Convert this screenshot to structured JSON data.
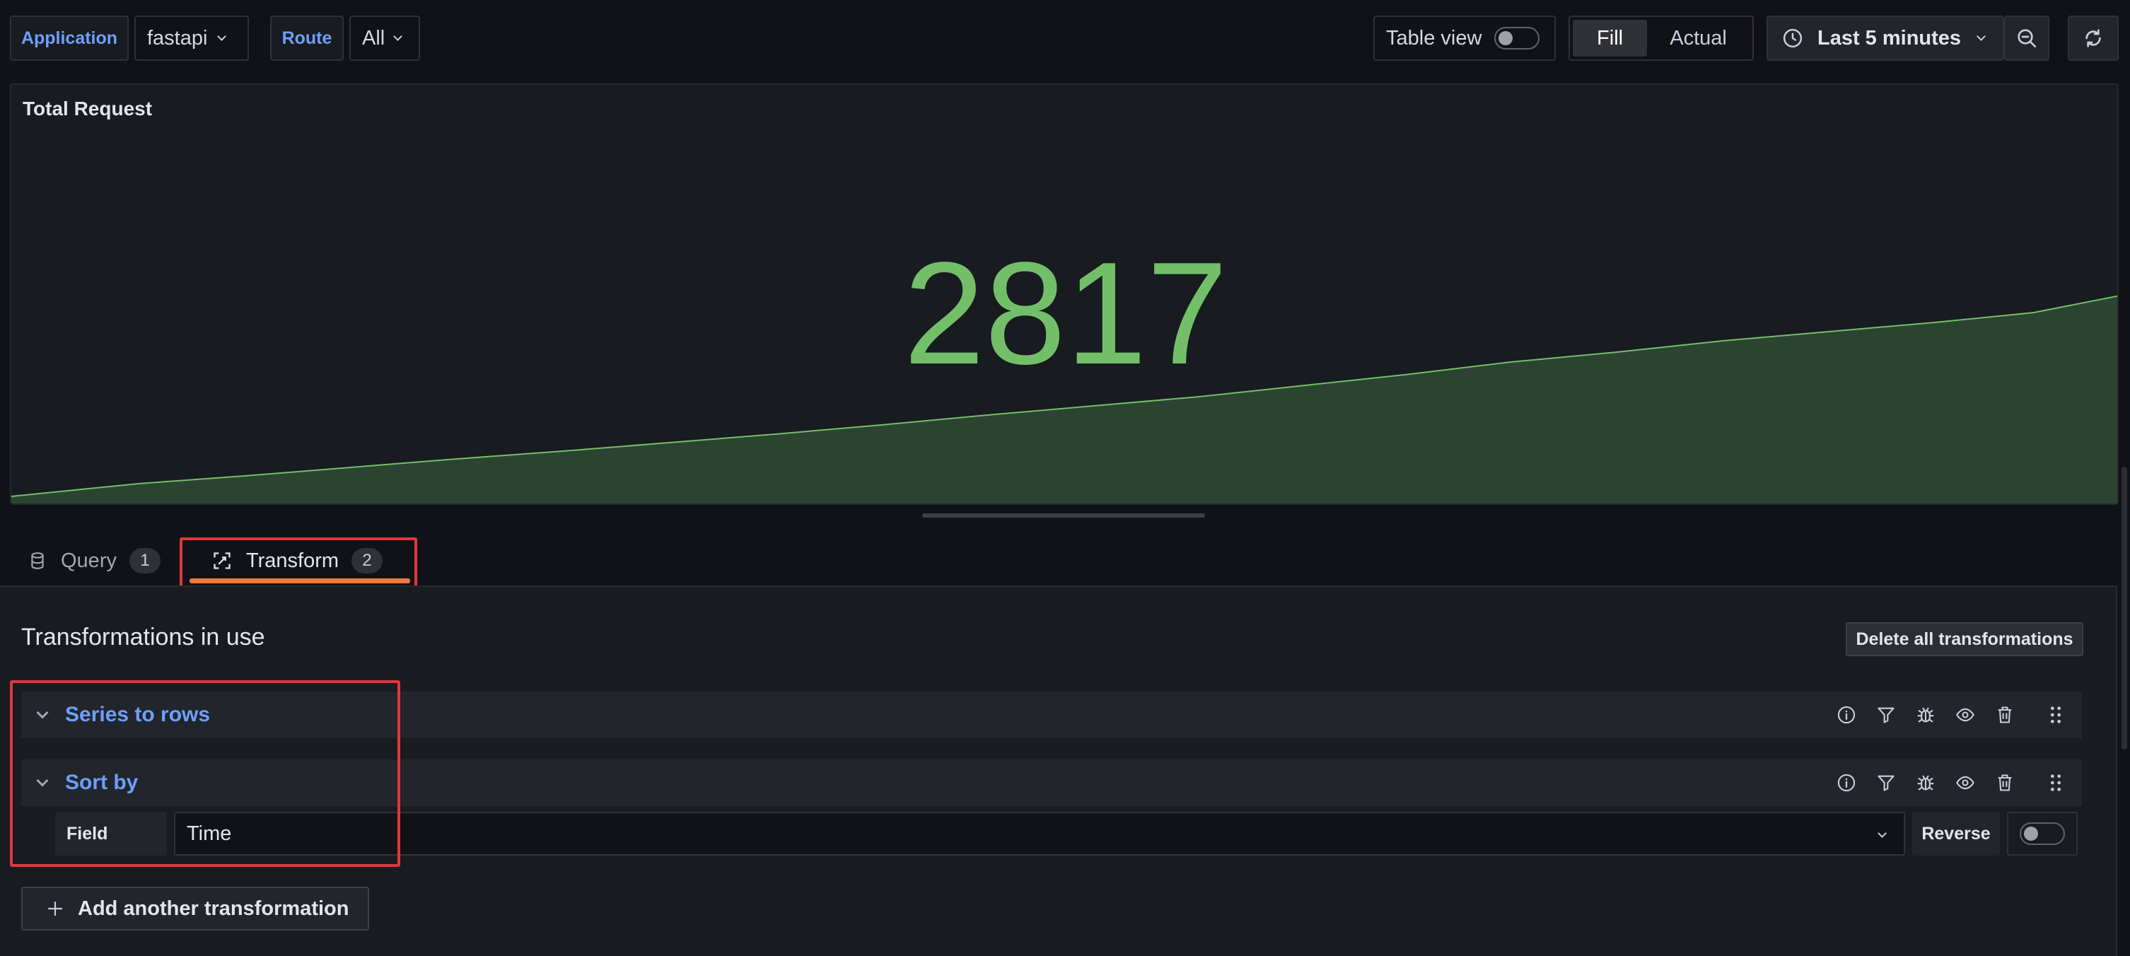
{
  "toolbar": {
    "application_label": "Application",
    "application_value": "fastapi",
    "route_label": "Route",
    "route_value": "All",
    "table_view_label": "Table view",
    "fill_label": "Fill",
    "actual_label": "Actual",
    "time_range": "Last 5 minutes"
  },
  "panel": {
    "title": "Total Request",
    "stat_value": "2817",
    "stat_color": "#73bf69",
    "sparkline_color": "#73bf69",
    "sparkline_fill": "#2b4432"
  },
  "editor_tabs": [
    {
      "label": "Query",
      "count": "1",
      "icon": "database-icon",
      "active": false
    },
    {
      "label": "Transform",
      "count": "2",
      "icon": "transform-icon",
      "active": true
    }
  ],
  "transformations": {
    "heading": "Transformations in use",
    "delete_all_label": "Delete all transformations",
    "items": [
      {
        "title": "Series to rows"
      },
      {
        "title": "Sort by",
        "field_label": "Field",
        "field_value": "Time",
        "reverse_label": "Reverse"
      }
    ],
    "add_label": "Add another transformation"
  },
  "colors": {
    "accent": "#6e9fff",
    "highlight": "#e0363f",
    "active_tab": "#f07a3a"
  }
}
